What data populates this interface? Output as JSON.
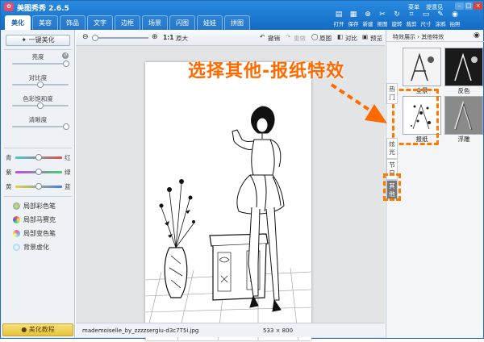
{
  "window": {
    "title": "美图秀秀 2.6.5",
    "links": [
      "菜单",
      "提意见"
    ],
    "controls": [
      "–",
      "□",
      "×"
    ]
  },
  "tabs": [
    "美化",
    "美容",
    "饰品",
    "文字",
    "边框",
    "场景",
    "闪图",
    "娃娃",
    "拼图"
  ],
  "toolbar": [
    {
      "label": "打开",
      "icon": "folder-icon",
      "glyph": "▤"
    },
    {
      "label": "保存",
      "icon": "save-icon",
      "glyph": "▦"
    },
    {
      "label": "新建",
      "icon": "new-icon",
      "glyph": "⊕"
    },
    {
      "label": "抠图",
      "icon": "cutout-icon",
      "glyph": "✂"
    },
    {
      "label": "旋转",
      "icon": "rotate-icon",
      "glyph": "↻"
    },
    {
      "label": "裁剪",
      "icon": "crop-icon",
      "glyph": "⌗"
    },
    {
      "label": "尺寸",
      "icon": "resize-icon",
      "glyph": "▭"
    },
    {
      "label": "涂鸦",
      "icon": "doodle-icon",
      "glyph": "✎"
    },
    {
      "label": "拍照",
      "icon": "camera-icon",
      "glyph": "◉"
    }
  ],
  "left": {
    "one_key": "一键美化",
    "sliders": [
      "亮度",
      "对比度",
      "色彩饱和度",
      "清晰度"
    ],
    "colors": [
      {
        "left": "青",
        "right": "红"
      },
      {
        "left": "紫",
        "right": "绿"
      },
      {
        "left": "黄",
        "right": "蓝"
      }
    ],
    "brushes": [
      "局部彩色笔",
      "局部马赛克",
      "局部变色笔",
      "背景虚化"
    ],
    "beauty_tutorial": "美化教程"
  },
  "canvas_toolbar": {
    "zoom_fit": "1:1",
    "original_size": "原大",
    "undo": "撤销",
    "redo": "重做",
    "original": "原图",
    "compare": "对比",
    "preview": "预览"
  },
  "status": {
    "filename": "mademoiselle_by_zzzzsergiu-d3c7T5i.jpg",
    "dimensions": "533 × 800"
  },
  "right": {
    "breadcrumb": "特效展示 › 其他特效",
    "effects": [
      {
        "label": "全景",
        "highlight": false
      },
      {
        "label": "反色",
        "highlight": false
      },
      {
        "label": "报纸",
        "highlight": true
      },
      {
        "label": "浮雕",
        "highlight": false
      }
    ],
    "side_tabs": [
      "热门",
      "炫光",
      "节日",
      "其他"
    ]
  },
  "annotation": {
    "text": "选择其他-报纸特效",
    "color": "#ff6a00"
  },
  "colors": {
    "accent": "#1b74cc",
    "annotation": "#ff6a00",
    "highlight_box": "#ff7a00"
  }
}
